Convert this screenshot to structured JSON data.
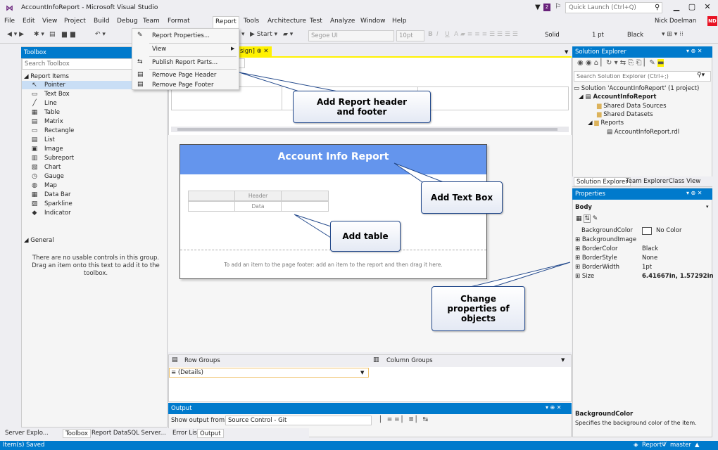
{
  "window": {
    "title": "AccountInfoReport - Microsoft Visual Studio",
    "quick_launch_placeholder": "Quick Launch (Ctrl+Q)",
    "notification_count": "2",
    "user": "Nick Doelman",
    "user_initials": "ND",
    "min_glyph": "▁",
    "max_glyph": "▢",
    "close_glyph": "✕"
  },
  "menu": [
    "File",
    "Edit",
    "View",
    "Project",
    "Build",
    "Debug",
    "Team",
    "Format",
    "Report",
    "Tools",
    "Architecture",
    "Test",
    "Analyze",
    "Window",
    "Help"
  ],
  "toolbar": {
    "start_label": "▶ Start ▾",
    "font": "Segoe UI",
    "font_size": "10pt",
    "line_style": "Solid",
    "line_width": "1 pt",
    "color": "Black"
  },
  "report_menu": {
    "items": [
      "Report Properties...",
      "View",
      "Publish Report Parts...",
      "Remove Page Header",
      "Remove Page Footer"
    ]
  },
  "toolbox": {
    "title": "Toolbox",
    "search_placeholder": "Search Toolbox",
    "group_report_items": "◢ Report Items",
    "items": [
      "Pointer",
      "Text Box",
      "Line",
      "Table",
      "Matrix",
      "Rectangle",
      "List",
      "Image",
      "Subreport",
      "Chart",
      "Gauge",
      "Map",
      "Data Bar",
      "Sparkline",
      "Indicator"
    ],
    "group_general": "◢ General",
    "general_message": "There are no usable controls in this group. Drag an item onto this text to add it to the toolbox.",
    "bottom_tabs": [
      "Server Explo...",
      "Toolbox",
      "Report Data",
      "SQL Server..."
    ]
  },
  "document": {
    "tab_label": "sign]",
    "pin_glyph": "⊕",
    "close_glyph": "✕"
  },
  "report": {
    "header_text": "Account Info Report",
    "table_header": "Header",
    "table_data": "Data",
    "footer_hint": "To add an item to the page footer: add an item to the report and then drag it here."
  },
  "groups": {
    "row_groups": "Row Groups",
    "column_groups": "Column Groups",
    "details": "≡ (Details)"
  },
  "output": {
    "title": "Output",
    "show_from_label": "Show output from:",
    "source": "Source Control - Git",
    "tabs": [
      "Error List",
      "Output"
    ]
  },
  "solution_explorer": {
    "title": "Solution Explorer",
    "search_placeholder": "Search Solution Explorer (Ctrl+;)",
    "tree": [
      "Solution 'AccountInfoReport' (1 project)",
      "AccountInfoReport",
      "Shared Data Sources",
      "Shared Datasets",
      "Reports",
      "AccountInfoReport.rdl"
    ],
    "tabs": [
      "Solution Explorer",
      "Team Explorer",
      "Class View"
    ]
  },
  "properties": {
    "title": "Properties",
    "object": "Body",
    "rows": [
      {
        "name": "BackgroundColor",
        "value": "No Color"
      },
      {
        "name": "⊞ BackgroundImage",
        "value": ""
      },
      {
        "name": "⊞ BorderColor",
        "value": "Black"
      },
      {
        "name": "⊞ BorderStyle",
        "value": "None"
      },
      {
        "name": "⊞ BorderWidth",
        "value": "1pt"
      },
      {
        "name": "⊞ Size",
        "value": "6.41667in, 1.57292in"
      }
    ],
    "desc_title": "BackgroundColor",
    "desc_text": "Specifies the background color of the item."
  },
  "status": {
    "left": "Item(s) Saved",
    "right_report": "Report",
    "right_branch": "master"
  },
  "callouts": {
    "header_footer": "Add Report header and footer",
    "text_box": "Add Text Box",
    "table": "Add table",
    "properties": "Change properties of objects"
  },
  "colors": {
    "accent": "#007acc",
    "report_header": "#6495ed",
    "doc_tab": "#fff200"
  }
}
